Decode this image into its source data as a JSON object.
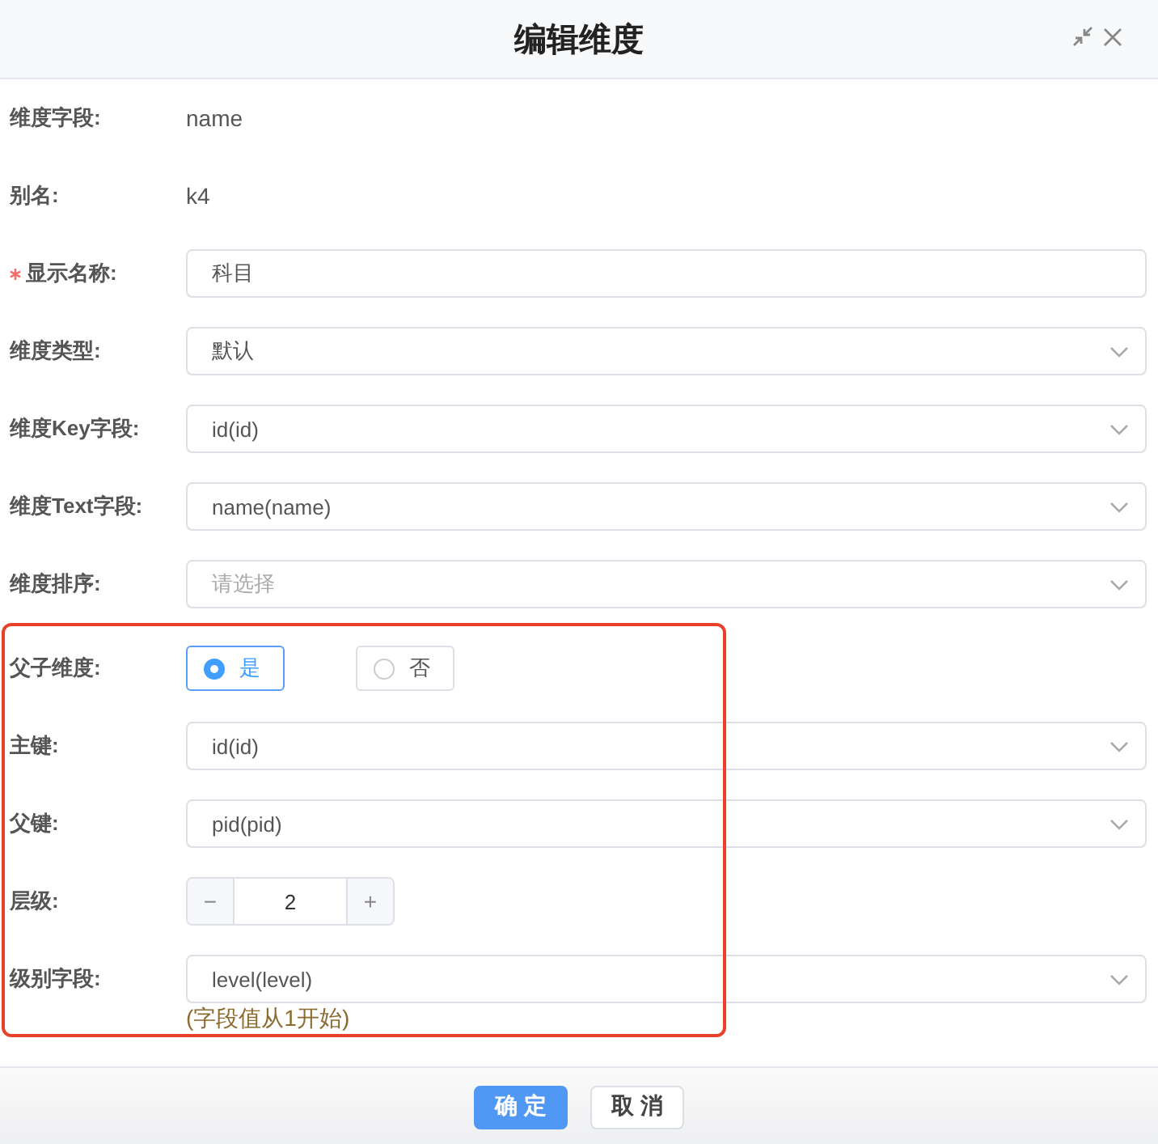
{
  "dialog": {
    "title": "编辑维度"
  },
  "fields": [
    {
      "kind": "text",
      "label": "维度字段:",
      "required": false,
      "value": "name"
    },
    {
      "kind": "text",
      "label": "别名:",
      "required": false,
      "value": "k4"
    },
    {
      "kind": "input",
      "label": "显示名称:",
      "required": true,
      "value": "科目"
    },
    {
      "kind": "select",
      "label": "维度类型:",
      "required": false,
      "value": "默认"
    },
    {
      "kind": "select",
      "label": "维度Key字段:",
      "required": false,
      "value": "id(id)"
    },
    {
      "kind": "select",
      "label": "维度Text字段:",
      "required": false,
      "value": "name(name)"
    },
    {
      "kind": "select",
      "label": "维度排序:",
      "required": false,
      "placeholder": "请选择"
    }
  ],
  "highlighted_fields": [
    {
      "kind": "radio",
      "label": "父子维度:",
      "required": false,
      "options": [
        {
          "label": "是",
          "selected": true
        },
        {
          "label": "否",
          "selected": false
        }
      ]
    },
    {
      "kind": "select",
      "label": "主键:",
      "required": false,
      "value": "id(id)"
    },
    {
      "kind": "select",
      "label": "父键:",
      "required": false,
      "value": "pid(pid)"
    },
    {
      "kind": "number",
      "label": "层级:",
      "required": false,
      "value": "2",
      "minus": "−",
      "plus": "+"
    },
    {
      "kind": "select",
      "label": "级别字段:",
      "required": false,
      "value": "level(level)",
      "hint": "(字段值从1开始)"
    }
  ],
  "buttons": [
    {
      "label": "确 定",
      "primary": true
    },
    {
      "label": "取 消",
      "primary": false
    }
  ]
}
